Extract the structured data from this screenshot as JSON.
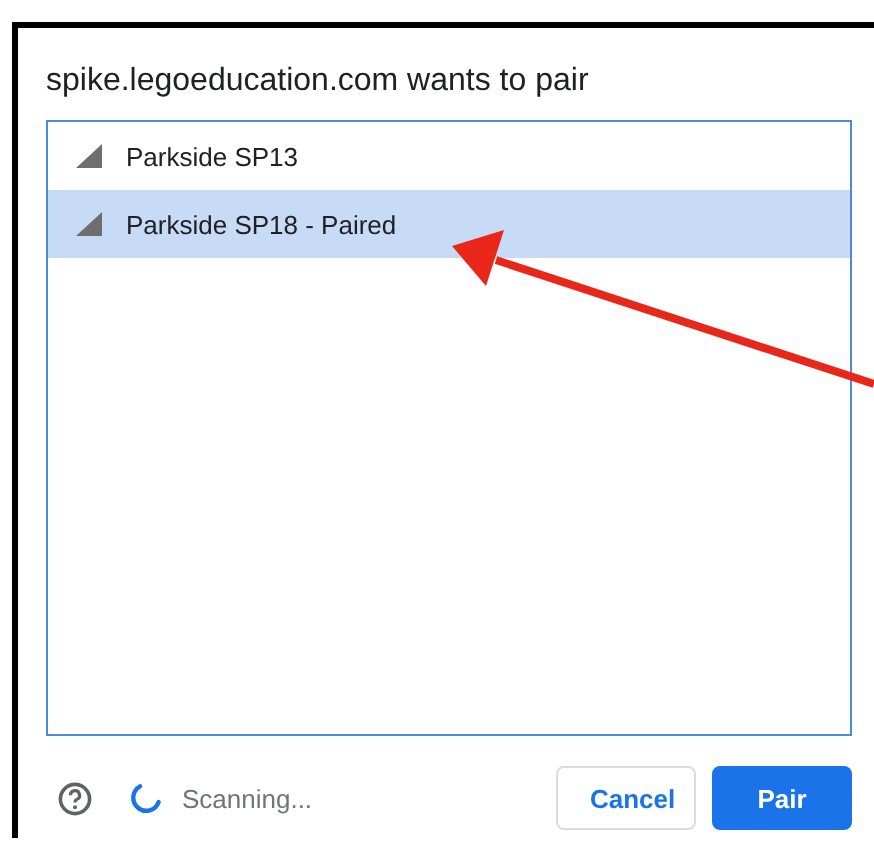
{
  "dialog": {
    "title": "spike.legoeducation.com wants to pair"
  },
  "devices": [
    {
      "name": "Parkside SP13",
      "selected": false
    },
    {
      "name": "Parkside SP18 - Paired",
      "selected": true
    }
  ],
  "status": {
    "text": "Scanning..."
  },
  "buttons": [
    {
      "label": "Cancel",
      "kind": "secondary"
    },
    {
      "label": "Pair",
      "kind": "primary"
    }
  ]
}
